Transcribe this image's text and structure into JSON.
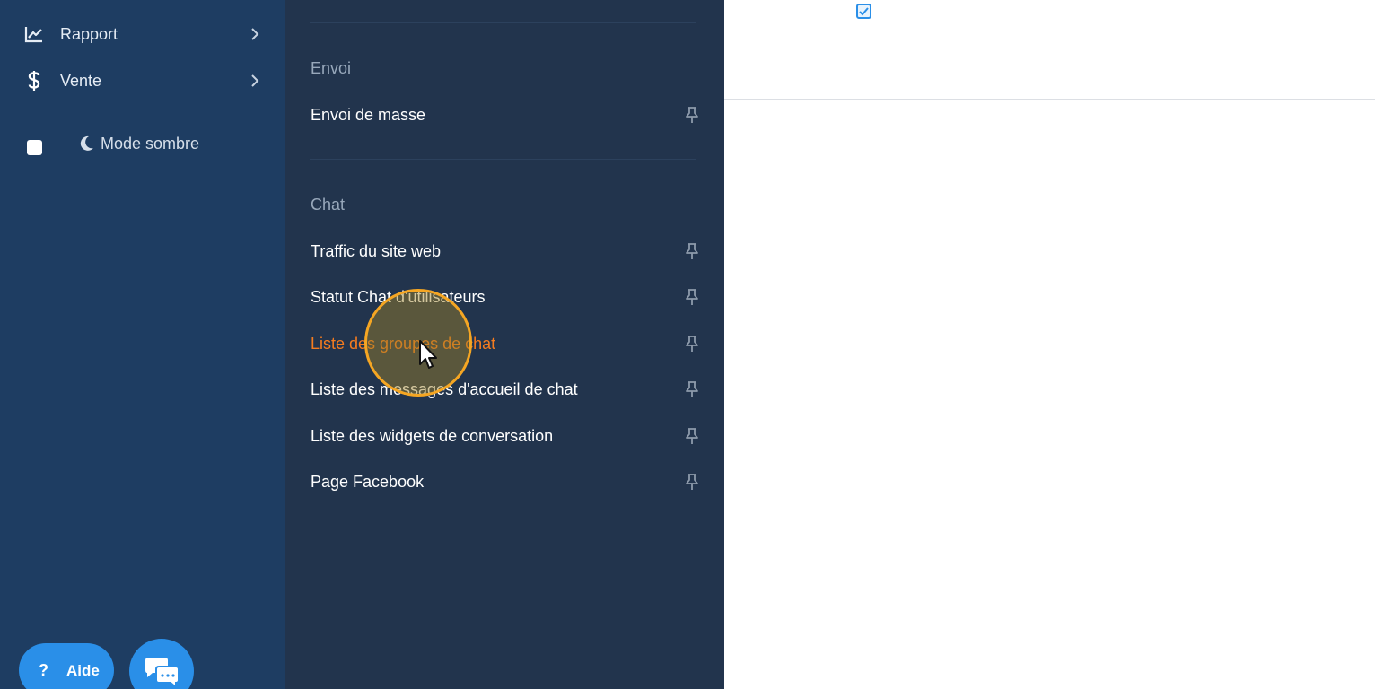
{
  "sidebar": {
    "items": [
      {
        "label": "Rapport",
        "icon": "chart-line-icon"
      },
      {
        "label": "Vente",
        "icon": "dollar-icon"
      }
    ],
    "dark_mode_label": "Mode sombre",
    "help_label": "Aide",
    "help_glyph": "?"
  },
  "panel": {
    "sections": [
      {
        "title": "Envoi",
        "items": [
          "Envoi de masse"
        ]
      },
      {
        "title": "Chat",
        "items": [
          "Traffic du site web",
          "Statut Chat d'utilisateurs",
          "Liste des groupes de chat",
          "Liste des messages d'accueil de chat",
          "Liste des widgets de conversation",
          "Page Facebook"
        ]
      }
    ],
    "active_item": "Liste des groupes de chat"
  },
  "colors": {
    "sidebar_bg": "#1e3d62",
    "panel_bg": "#22344d",
    "accent": "#2a8fe8",
    "active_text": "#f57c1f"
  }
}
